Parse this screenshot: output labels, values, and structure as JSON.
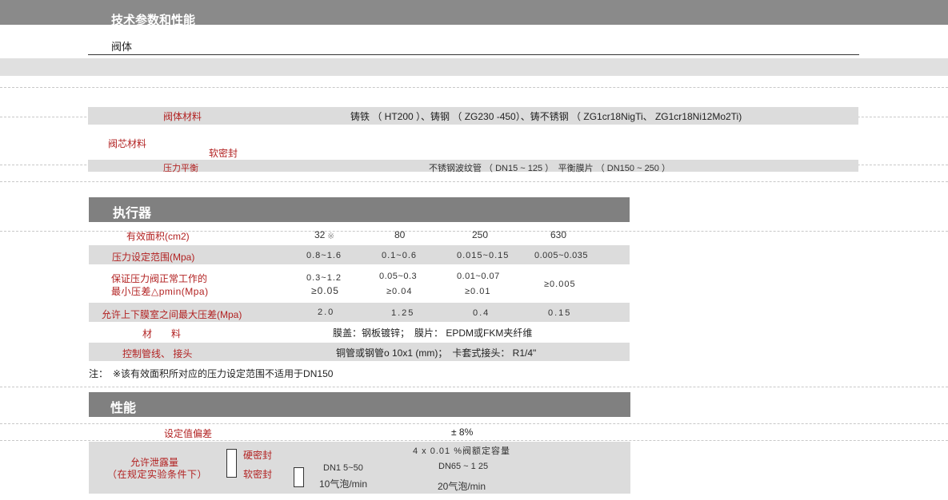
{
  "header": {
    "title": "技术参数和性能",
    "subtitle": "阀体"
  },
  "valve_body": {
    "material_label": "阀体材料",
    "material_value": "铸铁 （ HT200 ）、铸钢 （ ZG230 -450）、铸不锈钢 （ ZG1cr18NigTi、 ZG1cr18Ni12Mo2Ti)",
    "core_label": "阀芯材料",
    "core_value": "软密封",
    "balance_label": "压力平衡",
    "balance_value": "不锈钢波纹管 （ DN15 ~ 125 ）　平衡膜片 （ DN150 ~ 250 ）"
  },
  "actuator": {
    "title": "执行器",
    "area_label": "有效面积(cm2)",
    "area_values": [
      "32",
      "80",
      "250",
      "630"
    ],
    "area_mark": "※",
    "range_label": "压力设定范围(Mpa)",
    "range_values": [
      "0.8~1.6",
      "0.1~0.6",
      "0.015~0.15",
      "0.005~0.035"
    ],
    "min_diff_label_1": "保证压力阀正常工作的",
    "min_diff_label_2": "最小压差△pmin(Mpa)",
    "min_diff_top": [
      "0.3~1.2",
      "0.05~0.3",
      "0.01~0.07"
    ],
    "min_diff_bottom": [
      "≥0.05",
      "≥0.04",
      "≥0.01"
    ],
    "min_diff_last": "≥0.005",
    "max_diff_label": "允许上下膜室之间最大压差(Mpa)",
    "max_diff_values": [
      "2.0",
      "1.25",
      "0.4",
      "0.15"
    ],
    "material_label": "材　料",
    "material_value": "膜盖：钢板镀锌；　膜片： EPDM或FKM夹纤维",
    "pipe_label": "控制管线、 接头",
    "pipe_value": "铜管或钢管ο 10x1 (mm)；　卡套式接头： R1/4\""
  },
  "note": "注：　※该有效面积所对应的压力设定范围不适用于DN150",
  "performance": {
    "title": "性能",
    "deviation_label": "设定值偏差",
    "deviation_value": "± 8%",
    "leak_label_1": "允许泄露量",
    "leak_label_2": "（在规定实验条件下）",
    "hard_seal": "硬密封",
    "soft_seal": "软密封",
    "hard_value": "4 x 0.01 %阀额定容量",
    "dn_small": "DN1 5~50",
    "dn_large": "DN65 ~ 1 25",
    "bubbles_small": "10气泡/min",
    "bubbles_large": "20气泡/min"
  }
}
